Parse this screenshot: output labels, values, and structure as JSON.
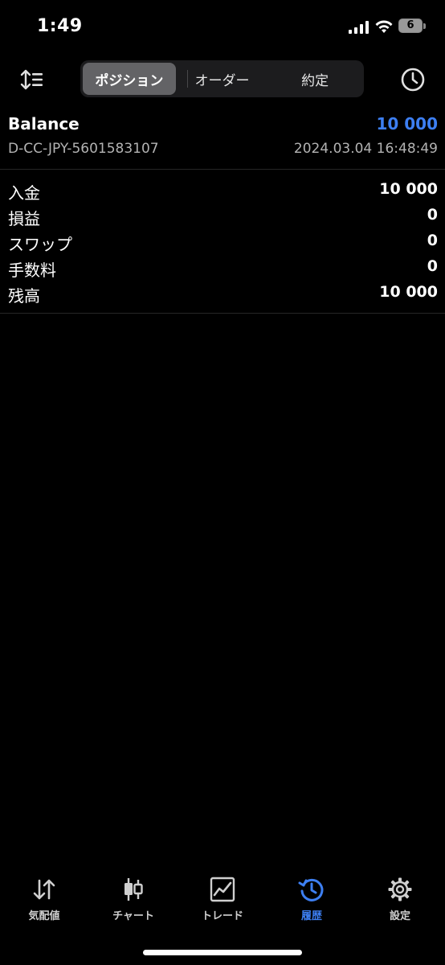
{
  "status_bar": {
    "time": "1:49",
    "battery_level": "6"
  },
  "toolbar": {
    "segments": [
      {
        "label": "ポジション",
        "active": true
      },
      {
        "label": "オーダー",
        "active": false
      },
      {
        "label": "約定",
        "active": false
      }
    ],
    "icons": {
      "left": "sort-icon",
      "right": "history-clock-icon"
    }
  },
  "balance": {
    "title": "Balance",
    "value": "10 000",
    "account": "D-CC-JPY-5601583107",
    "timestamp": "2024.03.04 16:48:49"
  },
  "details": [
    {
      "label": "入金",
      "value": "10 000"
    },
    {
      "label": "損益",
      "value": "0"
    },
    {
      "label": "スワップ",
      "value": "0"
    },
    {
      "label": "手数料",
      "value": "0"
    },
    {
      "label": "残高",
      "value": "10 000"
    }
  ],
  "tabbar": [
    {
      "label": "気配値",
      "icon": "quotes-arrows-icon",
      "active": false
    },
    {
      "label": "チャート",
      "icon": "candlestick-icon",
      "active": false
    },
    {
      "label": "トレード",
      "icon": "trade-chart-icon",
      "active": false
    },
    {
      "label": "履歴",
      "icon": "history-icon",
      "active": true
    },
    {
      "label": "設定",
      "icon": "gear-icon",
      "active": false
    }
  ],
  "colors": {
    "accent": "#3d7ff2",
    "background": "#000000",
    "segment_active": "#636366"
  }
}
